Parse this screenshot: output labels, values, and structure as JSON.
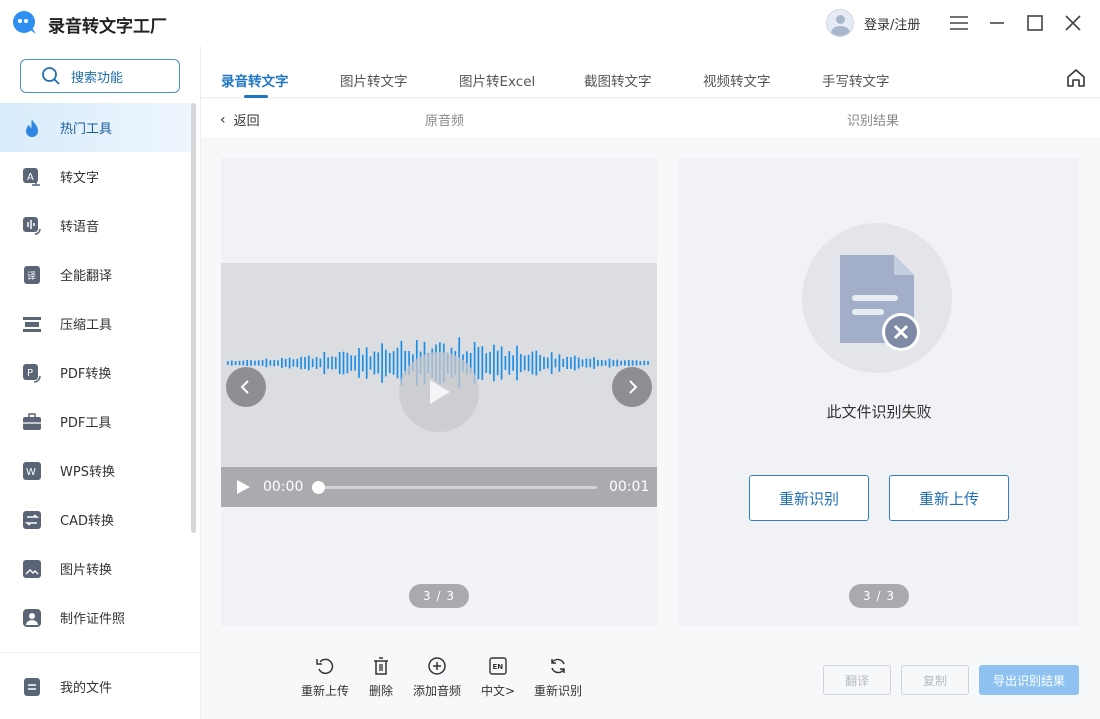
{
  "app": {
    "title": "录音转文字工厂",
    "login": "登录/注册"
  },
  "sidebar": {
    "search_placeholder": "搜索功能",
    "items": [
      {
        "label": "热门工具",
        "icon": "flame-icon"
      },
      {
        "label": "转文字",
        "icon": "text-convert-icon"
      },
      {
        "label": "转语音",
        "icon": "voice-icon"
      },
      {
        "label": "全能翻译",
        "icon": "translate-icon"
      },
      {
        "label": "压缩工具",
        "icon": "compress-icon"
      },
      {
        "label": "PDF转换",
        "icon": "pdf-convert-icon"
      },
      {
        "label": "PDF工具",
        "icon": "toolbox-icon"
      },
      {
        "label": "WPS转换",
        "icon": "wps-icon"
      },
      {
        "label": "CAD转换",
        "icon": "cad-icon"
      },
      {
        "label": "图片转换",
        "icon": "image-convert-icon"
      },
      {
        "label": "制作证件照",
        "icon": "id-photo-icon"
      }
    ],
    "my_files": "我的文件"
  },
  "tabs": [
    "录音转文字",
    "图片转文字",
    "图片转Excel",
    "截图转文字",
    "视频转文字",
    "手写转文字"
  ],
  "subbar": {
    "back": "返回",
    "original": "原音频",
    "result": "识别结果"
  },
  "player": {
    "current_time": "00:00",
    "duration": "00:01",
    "progress": 0.0,
    "pager": "3 / 3"
  },
  "result": {
    "fail_text": "此文件识别失败",
    "retry": "重新识别",
    "reupload": "重新上传",
    "pager": "3 / 3"
  },
  "toolbar": {
    "items": [
      {
        "label": "重新上传",
        "icon": "undo-icon"
      },
      {
        "label": "删除",
        "icon": "trash-icon"
      },
      {
        "label": "添加音频",
        "icon": "plus-circle-icon"
      },
      {
        "label": "中文>",
        "icon": "language-en-icon"
      },
      {
        "label": "重新识别",
        "icon": "refresh-icon"
      }
    ],
    "translate": "翻译",
    "copy": "复制",
    "export": "导出识别结果"
  },
  "colors": {
    "accent": "#1f76c4",
    "active_bg": "#d8ebfb"
  }
}
